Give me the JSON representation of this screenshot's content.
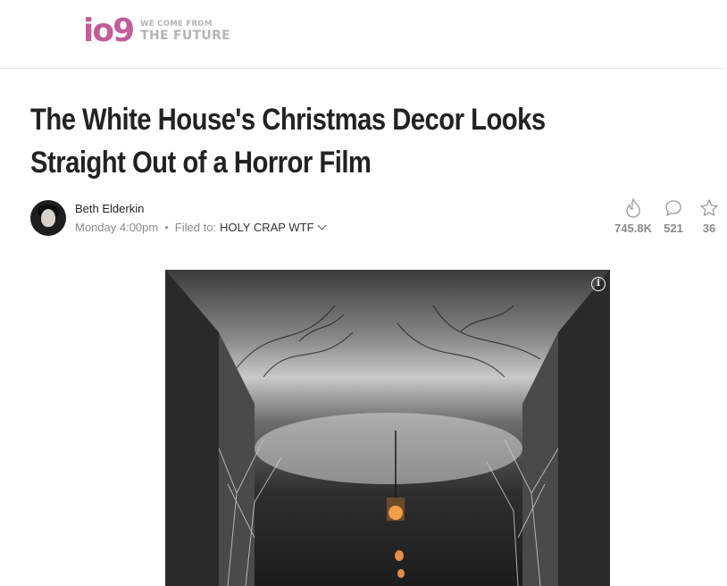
{
  "site": {
    "logo_text": "io9",
    "tagline_top": "WE COME FROM",
    "tagline_bottom": "THE FUTURE",
    "brand_color": "#c35d9a"
  },
  "article": {
    "title": "The White House's Christmas Decor Looks Straight Out of a Horror Film",
    "author": "Beth Elderkin",
    "timestamp": "Monday 4:00pm",
    "filed_to_label": "Filed to:",
    "filed_to_tag": "HOLY CRAP WTF"
  },
  "stats": {
    "views": "745.8K",
    "comments": "521",
    "recommends": "36"
  },
  "icons": {
    "views": "flame-icon",
    "comments": "comment-bubble-icon",
    "recommends": "star-icon",
    "image_info": "info-icon",
    "dropdown": "chevron-down-icon"
  }
}
